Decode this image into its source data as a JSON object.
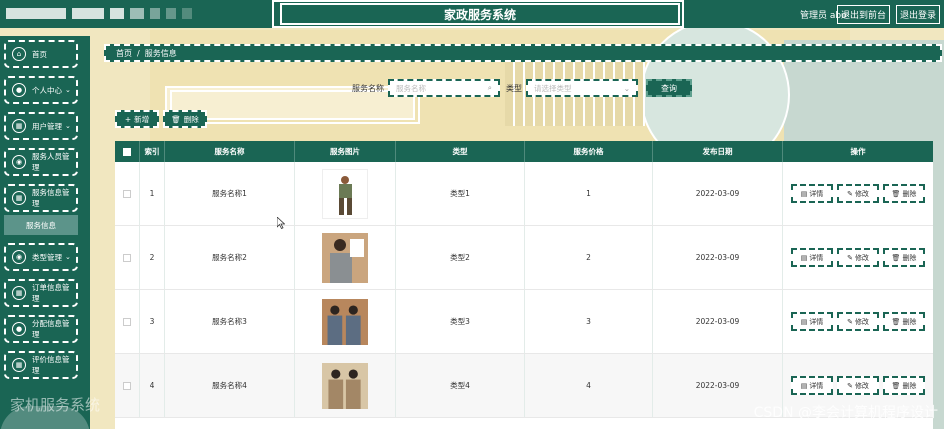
{
  "header": {
    "title": "家政服务系统",
    "user_text": "管理员 abo",
    "goto_front": "退出到前台",
    "logout": "退出登录"
  },
  "sidebar": {
    "items": [
      {
        "label": "首页",
        "icon": "home-icon",
        "chevron": false
      },
      {
        "label": "个人中心",
        "icon": "user-icon",
        "chevron": true
      },
      {
        "label": "用户管理",
        "icon": "grid-icon",
        "chevron": true
      },
      {
        "label": "服务人员管理",
        "icon": "location-icon",
        "chevron": false
      },
      {
        "label": "服务信息管理",
        "icon": "grid-icon",
        "chevron": false
      },
      {
        "label": "类型管理",
        "icon": "location-icon",
        "chevron": true
      },
      {
        "label": "订单信息管理",
        "icon": "grid-icon",
        "chevron": false
      },
      {
        "label": "分配信息管理",
        "icon": "user-icon",
        "chevron": false
      },
      {
        "label": "评价信息管理",
        "icon": "grid-icon",
        "chevron": false
      }
    ],
    "active_sub": "服务信息"
  },
  "breadcrumb": {
    "home": "首页",
    "sep": "/",
    "current": "服务信息"
  },
  "search": {
    "name_label": "服务名称",
    "name_placeholder": "服务名称",
    "type_label": "类型",
    "type_placeholder": "请选择类型",
    "button": "查询"
  },
  "actions": {
    "add": "新增",
    "delete": "删除"
  },
  "table": {
    "columns": [
      "索引",
      "服务名称",
      "服务图片",
      "类型",
      "服务价格",
      "发布日期",
      "操作"
    ],
    "rows": [
      {
        "index": "1",
        "name": "服务名称1",
        "type": "类型1",
        "price": "1",
        "date": "2022-03-09"
      },
      {
        "index": "2",
        "name": "服务名称2",
        "type": "类型2",
        "price": "2",
        "date": "2022-03-09"
      },
      {
        "index": "3",
        "name": "服务名称3",
        "type": "类型3",
        "price": "3",
        "date": "2022-03-09"
      },
      {
        "index": "4",
        "name": "服务名称4",
        "type": "类型4",
        "price": "4",
        "date": "2022-03-09"
      }
    ],
    "op_labels": {
      "detail": "详情",
      "edit": "修改",
      "delete": "删除"
    }
  },
  "watermarks": {
    "left": "家机服务系统",
    "right": "CSDN @李会计算机程序设计"
  },
  "colors": {
    "primary": "#1a6554",
    "background": "#f1e7c0"
  }
}
